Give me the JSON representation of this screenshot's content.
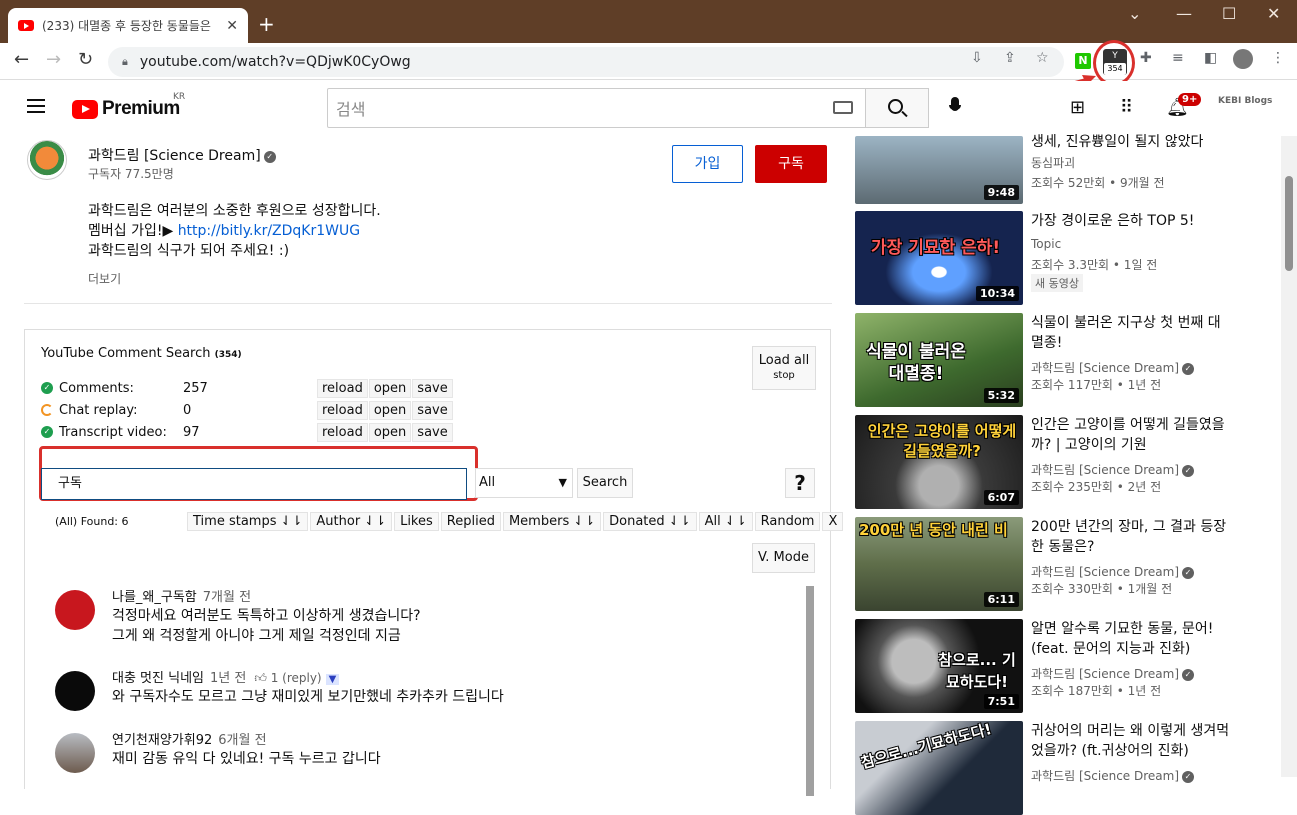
{
  "browser": {
    "tab_title": "(233) 대멸종 후 등장한 동물들은",
    "tab_close": "✕",
    "new_tab": "+",
    "url": "youtube.com/watch?v=QDjwK0CyOwg",
    "ext_badge": "354",
    "ext_n": "N",
    "win_min": "⌄",
    "win_min2": "—",
    "win_max": "☐",
    "win_close": "✕"
  },
  "youtube_header": {
    "logo": "Premium",
    "region": "KR",
    "search_placeholder": "검색",
    "notif_badge": "9+",
    "avatar_text": "KEBI Blogs"
  },
  "channel": {
    "name": "과학드림 [Science Dream]",
    "subscribers": "구독자 77.5만명",
    "join_label": "가입",
    "subscribe_label": "구독",
    "desc_line1": "과학드림은 여러분의 소중한 후원으로 성장합니다.",
    "desc_line2_prefix": "멤버십 가입!▶ ",
    "desc_link": "http://bitly.kr/ZDqKr1WUG",
    "desc_line3": "과학드림의 식구가 되어 주세요! :)",
    "more": "더보기"
  },
  "ycs": {
    "title": "YouTube Comment Search",
    "count": "(354)",
    "load_all": "Load all",
    "stop": "stop",
    "rows": [
      {
        "label": "Comments:",
        "value": "257",
        "reload": "reload",
        "open": "open",
        "save": "save"
      },
      {
        "label": "Chat replay:",
        "value": "0",
        "reload": "reload",
        "open": "open",
        "save": "save"
      },
      {
        "label": "Transcript video:",
        "value": "97",
        "reload": "reload",
        "open": "open",
        "save": "save"
      }
    ],
    "query": "구독",
    "scope": "All",
    "search_label": "Search",
    "help": "?",
    "found": "(All) Found: 6",
    "filters": [
      "Time stamps ⇃⇂",
      "Author ⇃⇂",
      "Likes",
      "Replied",
      "Members ⇃⇂",
      "Donated ⇃⇂",
      "All ⇃⇂",
      "Random",
      "X"
    ],
    "vmode": "V. Mode",
    "comments": [
      {
        "author": "나를_왜_구독함",
        "time": "7개월 전",
        "line1": "걱정마세요 여러분도 독특하고 이상하게 생겼습니다?",
        "line2": "그게 왜 걱정할게 아니야 그게 제일 걱정인데 지금",
        "avatar_color": "#c8171e"
      },
      {
        "author": "대충 멋진 닉네임",
        "time": "1년 전",
        "likes": "1 (reply)",
        "line1": "와 구독자수도 모르고 그냥 재미있게 보기만했네 추카추카 드립니다",
        "avatar_color": "#0a0a0a"
      },
      {
        "author": "연기천재양가휘92",
        "time": "6개월 전",
        "line1": "재미 감동 유익 다 있네요! 구독 누르고 갑니다",
        "avatar_color": "#8a8f96"
      }
    ]
  },
  "sidebar": [
    {
      "title": "생세, 진유쁑일이 될지 않았다",
      "channel": "동심파괴",
      "views": "조회수 52만회 • 9개월 전",
      "duration": "9:48",
      "bg": "#7a8fa0",
      "thumb_text": ""
    },
    {
      "title": "가장 경이로운 은하 TOP 5!",
      "channel": "Topic",
      "views": "조회수 3.3만회 • 1일 전",
      "badge": "새 동영상",
      "duration": "10:34",
      "bg": "#15244f",
      "thumb_text": "가장 기묘한 은하!",
      "thumb_color": "#ff5a5a"
    },
    {
      "title": "식물이 불러온 지구상 첫 번째 대멸종!",
      "channel": "과학드림 [Science Dream]",
      "views": "조회수 117만회 • 1년 전",
      "duration": "5:32",
      "bg": "#4f7a3a",
      "thumb_text": "식물이 불러온 대멸종!",
      "thumb_color": "#ffffff"
    },
    {
      "title": "인간은 고양이를 어떻게 길들였을까? | 고양이의 기원",
      "channel": "과학드림 [Science Dream]",
      "views": "조회수 235만회 • 2년 전",
      "duration": "6:07",
      "bg": "#3a3a3a",
      "thumb_text": "인간은 고양이를 어떻게 길들였을까?",
      "thumb_color": "#ffd23a"
    },
    {
      "title": "200만 년간의 장마, 그 결과 등장한 동물은?",
      "channel": "과학드림 [Science Dream]",
      "views": "조회수 330만회 • 1개월 전",
      "duration": "6:11",
      "bg": "#5f6e4a",
      "thumb_text": "200만 년 동안 내린 비",
      "thumb_color": "#ffd23a"
    },
    {
      "title": "알면 알수록 기묘한 동물, 문어! (feat. 문어의 지능과 진화)",
      "channel": "과학드림 [Science Dream]",
      "views": "조회수 187만회 • 1년 전",
      "duration": "7:51",
      "bg": "#1a1a1a",
      "thumb_text": "참으로... 기묘하도다!",
      "thumb_color": "#ffffff"
    },
    {
      "title": "귀상어의 머리는 왜 이렇게 생겨먹었을까? (ft.귀상어의 진화)",
      "channel": "과학드림 [Science Dream]",
      "views": "",
      "duration": "",
      "bg": "#1f2a3a",
      "thumb_text": "참으로...기묘하도다!",
      "thumb_color": "#ffffff"
    }
  ]
}
